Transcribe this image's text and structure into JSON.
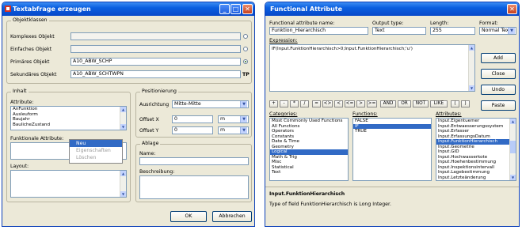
{
  "left_window": {
    "title": "Textabfrage erzeugen",
    "objektklassen": {
      "group_label": "Objektklassen",
      "rows": [
        {
          "label": "Komplexes Objekt",
          "value": "",
          "radio": "empty"
        },
        {
          "label": "Einfaches Objekt",
          "value": "",
          "radio": "empty"
        },
        {
          "label": "Primäres Objekt",
          "value": "A10_ABW_SCHP",
          "radio": "selected"
        },
        {
          "label": "Sekundäres Objekt",
          "value": "A10_ABW_SCHTWPN",
          "radio": "TP"
        }
      ]
    },
    "inhalt": {
      "group_label": "Inhalt",
      "attribute_label": "Attribute:",
      "attributes": [
        "AnFunktion",
        "Ausleuform",
        "Baujahr",
        "BaulicheZustand"
      ],
      "funktionale_label": "Funktionale Attribute:",
      "context_menu": [
        "Neu",
        "Eigenschaften",
        "Löschen"
      ],
      "layout_label": "Layout:"
    },
    "positionierung": {
      "group_label": "Positionierung",
      "ausrichtung_label": "Ausrichtung",
      "ausrichtung_value": "Mitte-Mitte",
      "offset_x_label": "Offset X",
      "offset_x_value": "0",
      "offset_x_unit": "m",
      "offset_y_label": "Offset Y",
      "offset_y_value": "0",
      "offset_y_unit": "m"
    },
    "ablage": {
      "group_label": "Ablage",
      "name_label": "Name:",
      "beschreibung_label": "Beschreibung:"
    },
    "ok_label": "OK",
    "cancel_label": "Abbrechen"
  },
  "right_window": {
    "title": "Functional Attribute",
    "name_label": "Functional attribute name:",
    "name_value": "Funktion_Hierarchisch",
    "output_label": "Output type:",
    "output_value": "Text",
    "length_label": "Length:",
    "length_value": "255",
    "format_label": "Format:",
    "format_value": "Normal Text",
    "expression_label": "Expression:",
    "expression_value": "IF(Input.FunktionHierarchisch>0;Input.FunktionHierarchisch;'u')",
    "buttons": [
      "Add",
      "Close",
      "Undo",
      "Paste"
    ],
    "operators": [
      "+",
      "-",
      "*",
      "/",
      "=",
      "<>",
      "<",
      "<=",
      ">",
      ">=",
      "AND",
      "OR",
      "NOT",
      "LIKE",
      "(",
      ")"
    ],
    "categories_label": "Categories:",
    "categories": [
      "Most Commonly Used Functions",
      "All Functions",
      "Operators",
      "Constants",
      "Date & Time",
      "Geometry",
      "Logical",
      "Math & Trig",
      "Misc",
      "Statistical",
      "Text"
    ],
    "categories_selected": 6,
    "functions_label": "Functions:",
    "functions": [
      "FALSE",
      "IF",
      "TRUE"
    ],
    "functions_selected": 1,
    "attributes_label": "Attributes:",
    "attributes": [
      "Input.Eigentuemer",
      "Input.Entwaesserungssystem",
      "Input.Erfasser",
      "Input.ErfassungsDatum",
      "Input.FunktionHierarchisch",
      "Input.Geometrie",
      "Input.GID",
      "Input.Hochwasserkote",
      "Input.Hoehenbestimmung",
      "Input.Inspektionsintervall",
      "Input.Lagebestimmung",
      "Input.Letzteänderung"
    ],
    "attributes_selected": 4,
    "info_title": "Input.FunktionHierarchisch",
    "info_text": "Type of field FunktionHierarchisch is Long Integer."
  },
  "colors": {
    "titlebar": "#0a5fe0",
    "selection": "#316ac5",
    "window_bg": "#ece9d8"
  }
}
